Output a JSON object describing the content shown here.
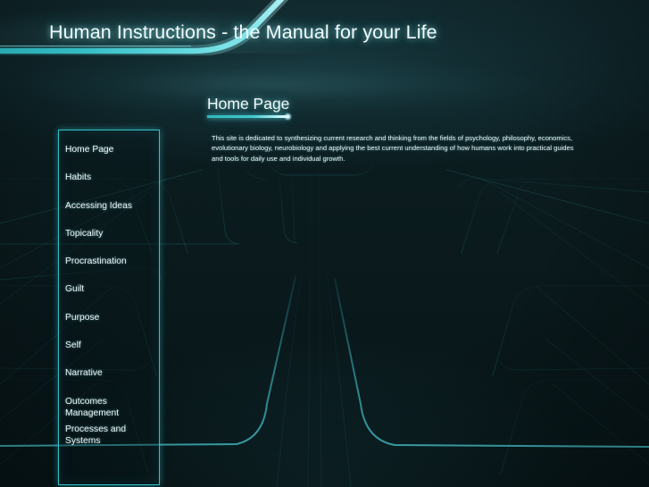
{
  "slide": {
    "title": "Human Instructions - the Manual for your Life",
    "accent_color": "#2ec3cb",
    "accent_bright": "#7fe8ee",
    "background_color": "#0a1c1f",
    "text_color": "#eef7f8"
  },
  "content": {
    "page_heading": "Home Page",
    "body_paragraph": "This site is dedicated to synthesizing current research and thinking from the fields of psychology, philosophy, economics, evolutionary biology, neurobiology and applying the best current understanding of how humans work into practical guides and tools for daily use and individual growth."
  },
  "menu": {
    "items": [
      {
        "label": "Home Page"
      },
      {
        "label": "Habits"
      },
      {
        "label": "Accessing Ideas"
      },
      {
        "label": "Topicality"
      },
      {
        "label": "Procrastination"
      },
      {
        "label": "Guilt"
      },
      {
        "label": "Purpose"
      },
      {
        "label": "Self"
      },
      {
        "label": "Narrative"
      },
      {
        "label": "Outcomes Management"
      },
      {
        "label": "Processes and Systems"
      }
    ]
  }
}
